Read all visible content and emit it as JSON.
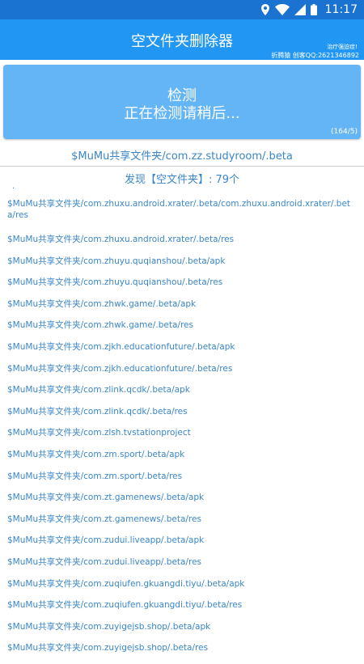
{
  "status_bar": {
    "time": "11:17"
  },
  "app_bar": {
    "title": "空文件夹删除器",
    "subtitle1": "治疗强迫症!",
    "subtitle2": "折腾猿 创客QQ:2621346892"
  },
  "detect": {
    "title": "检测",
    "status": "正在检测请稍后...",
    "counter": "(164/5)"
  },
  "current_path": "$MuMu共享文件夹/com.zz.studyroom/.beta",
  "found_summary": "发现【空文件夹】: 79个",
  "dot": ".",
  "results": [
    "$MuMu共享文件夹/com.zhuxu.android.xrater/.beta/com.zhuxu.android.xrater/.beta/res",
    "$MuMu共享文件夹/com.zhuxu.android.xrater/.beta/res",
    "$MuMu共享文件夹/com.zhuyu.quqianshou/.beta/apk",
    "$MuMu共享文件夹/com.zhuyu.quqianshou/.beta/res",
    "$MuMu共享文件夹/com.zhwk.game/.beta/apk",
    "$MuMu共享文件夹/com.zhwk.game/.beta/res",
    "$MuMu共享文件夹/com.zjkh.educationfuture/.beta/apk",
    "$MuMu共享文件夹/com.zjkh.educationfuture/.beta/res",
    "$MuMu共享文件夹/com.zlink.qcdk/.beta/apk",
    "$MuMu共享文件夹/com.zlink.qcdk/.beta/res",
    "$MuMu共享文件夹/com.zlsh.tvstationproject",
    "$MuMu共享文件夹/com.zm.sport/.beta/apk",
    "$MuMu共享文件夹/com.zm.sport/.beta/res",
    "$MuMu共享文件夹/com.zt.gamenews/.beta/apk",
    "$MuMu共享文件夹/com.zt.gamenews/.beta/res",
    "$MuMu共享文件夹/com.zudui.liveapp/.beta/apk",
    "$MuMu共享文件夹/com.zudui.liveapp/.beta/res",
    "$MuMu共享文件夹/com.zuqiufen.gkuangdi.tiyu/.beta/apk",
    "$MuMu共享文件夹/com.zuqiufen.gkuangdi.tiyu/.beta/res",
    "$MuMu共享文件夹/com.zuyigejsb.shop/.beta/apk",
    "$MuMu共享文件夹/com.zuyigejsb.shop/.beta/res"
  ]
}
